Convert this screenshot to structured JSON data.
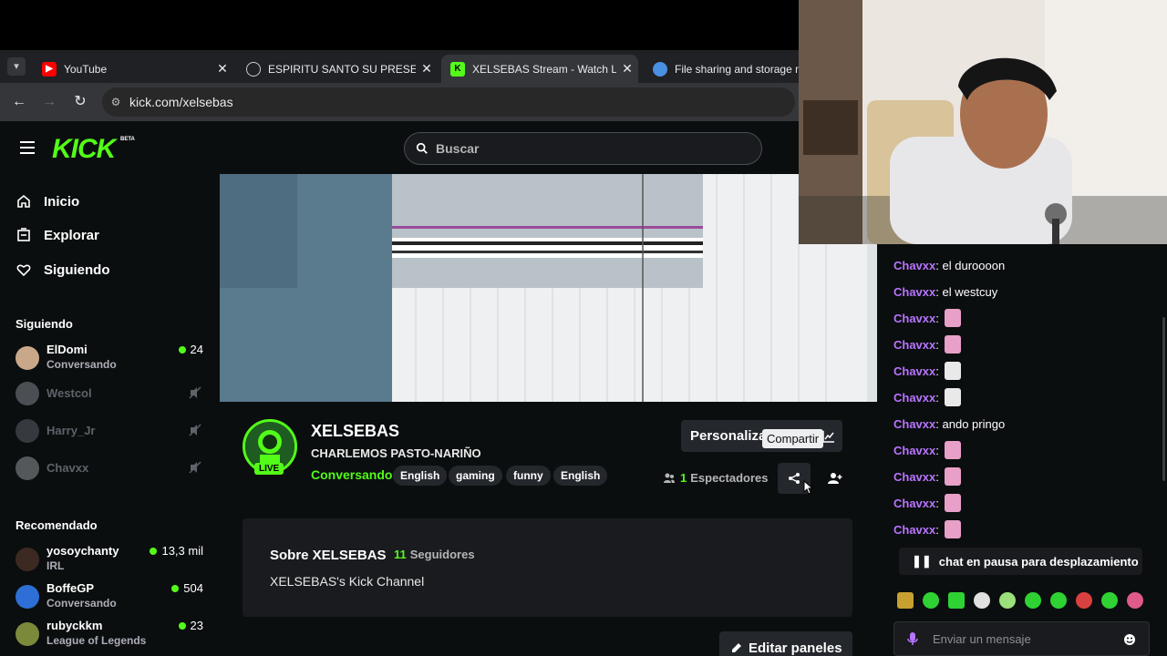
{
  "browser": {
    "tabs": [
      {
        "title": "YouTube",
        "favicon": "youtube-icon"
      },
      {
        "title": "ESPIRITU SANTO SU PRESENCIA",
        "favicon": "globe-icon"
      },
      {
        "title": "XELSEBAS Stream - Watch Live",
        "favicon": "kick-icon"
      },
      {
        "title": "File sharing and storage made",
        "favicon": "cloud-icon"
      }
    ],
    "active_tab_index": 2,
    "url": "kick.com/xelsebas"
  },
  "header": {
    "logo": "KICK",
    "beta": "BETA",
    "search_placeholder": "Buscar"
  },
  "nav": {
    "items": [
      {
        "label": "Inicio",
        "icon": "home-icon"
      },
      {
        "label": "Explorar",
        "icon": "compass-icon"
      },
      {
        "label": "Siguiendo",
        "icon": "heart-icon"
      }
    ]
  },
  "following": {
    "title": "Siguiendo",
    "channels": [
      {
        "name": "ElDomi",
        "category": "Conversando",
        "viewers": "24",
        "live": true
      },
      {
        "name": "Westcol",
        "live": false
      },
      {
        "name": "Harry_Jr",
        "live": false
      },
      {
        "name": "Chavxx",
        "live": false
      }
    ]
  },
  "recommended": {
    "title": "Recomendado",
    "channels": [
      {
        "name": "yosoychanty",
        "category": "IRL",
        "viewers": "13,3 mil"
      },
      {
        "name": "BoffeGP",
        "category": "Conversando",
        "viewers": "504"
      },
      {
        "name": "rubyckkm",
        "category": "League of Legends",
        "viewers": "23"
      }
    ]
  },
  "channel": {
    "name": "XELSEBAS",
    "live_badge": "LIVE",
    "title": "CHARLEMOS PASTO-NARIÑO",
    "category": "Conversando",
    "tags": [
      "English",
      "gaming",
      "funny",
      "English"
    ],
    "customize_label": "Personaliza",
    "share_tooltip": "Compartir",
    "viewers_count": "1",
    "viewers_label": "Espectadores"
  },
  "about": {
    "title": "Sobre XELSEBAS",
    "followers_count": "11",
    "followers_label": "Seguidores",
    "description": "XELSEBAS's Kick Channel",
    "edit_panels_label": "Editar paneles"
  },
  "chat": {
    "messages": [
      {
        "user": "Chavxx",
        "text": "el duroooon"
      },
      {
        "user": "Chavxx",
        "text": "el westcuy"
      },
      {
        "user": "Chavxx",
        "text": "",
        "emote": "pink"
      },
      {
        "user": "Chavxx",
        "text": "",
        "emote": "pink"
      },
      {
        "user": "Chavxx",
        "text": "",
        "emote": "white"
      },
      {
        "user": "Chavxx",
        "text": "",
        "emote": "white"
      },
      {
        "user": "Chavxx",
        "text": "ando pringo"
      },
      {
        "user": "Chavxx",
        "text": "",
        "emote": "pink"
      },
      {
        "user": "Chavxx",
        "text": "",
        "emote": "pink"
      },
      {
        "user": "Chavxx",
        "text": "",
        "emote": "pink"
      },
      {
        "user": "Chavxx",
        "text": "",
        "emote": "pink"
      }
    ],
    "separator": ":",
    "paused_label": "chat en pausa para desplazamiento",
    "input_placeholder": "Enviar un mensaje"
  },
  "colors": {
    "brand": "#53fc18",
    "username": "#b774ff",
    "background": "#0b0e0f"
  }
}
